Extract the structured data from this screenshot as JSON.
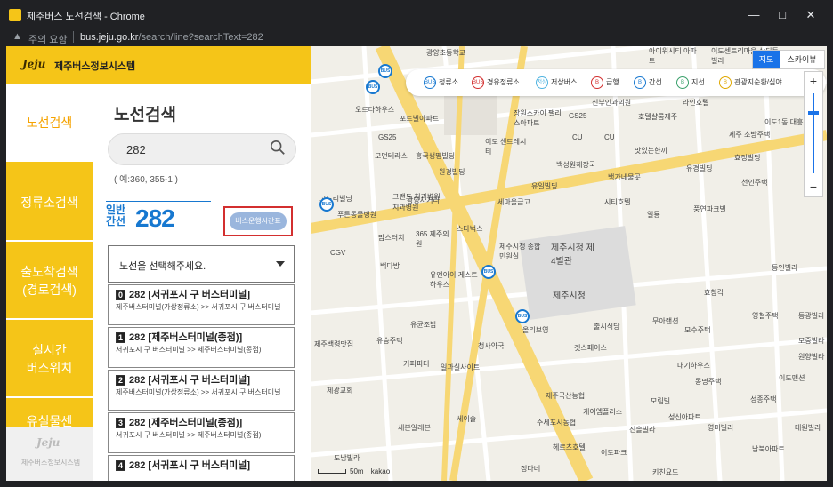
{
  "browser": {
    "title": "제주버스 노선검색 - Chrome",
    "security_note": "주의 요함",
    "url_host": "bus.jeju.go.kr",
    "url_path": "/search/line?searchText=282"
  },
  "header": {
    "logo_mark": "Jeju",
    "logo_text": "제주버스정보시스템"
  },
  "sidebar": {
    "items": [
      {
        "label": "노선검색",
        "active": true
      },
      {
        "label": "정류소검색"
      },
      {
        "label": "출도착검색",
        "label2": "(경로검색)"
      },
      {
        "label": "실시간",
        "label2": "버스위치"
      },
      {
        "label": "유실물센"
      }
    ],
    "footer_mark": "Jeju",
    "footer_text": "제주버스정보시스템"
  },
  "main": {
    "title": "노선검색",
    "search_value": "282",
    "example": "( 예:360, 355-1 )",
    "route_type_line1": "일반",
    "route_type_line2": "간선",
    "route_number": "282",
    "schedule_button": "버스운행시간표",
    "select_placeholder": "노선을 선택해주세요.",
    "routes": [
      {
        "index": "0",
        "title": "282 [서귀포시 구 버스터미널]",
        "desc": "제주버스터미널(가상정류소) >> 서귀포시 구 버스터미널"
      },
      {
        "index": "1",
        "title": "282 [제주버스터미널(종점)]",
        "desc": "서귀포시 구 버스터미널 >> 제주버스터미널(종점)"
      },
      {
        "index": "2",
        "title": "282 [서귀포시 구 버스터미널]",
        "desc": "제주버스터미널(가상정류소) >> 서귀포시 구 버스터미널"
      },
      {
        "index": "3",
        "title": "282 [제주버스터미널(종점)]",
        "desc": "서귀포시 구 버스터미널 >> 제주버스터미널(종점)"
      },
      {
        "index": "4",
        "title": "282 [서귀포시 구 버스터미널]",
        "desc": ""
      }
    ]
  },
  "map": {
    "map_type_on": "지도",
    "map_type_off": "스카이뷰",
    "zoom_in": "+",
    "zoom_out": "−",
    "legend": [
      {
        "label": "정류소",
        "color": "#1778d0",
        "icon": "BUS"
      },
      {
        "label": "경유정류소",
        "color": "#d32f2f",
        "icon": "BUS"
      },
      {
        "label": "저상버스",
        "color": "#4fb3e0",
        "icon": "저상"
      },
      {
        "label": "급행",
        "color": "#d32f2f",
        "icon": "B"
      },
      {
        "label": "간선",
        "color": "#1778d0",
        "icon": "B"
      },
      {
        "label": "지선",
        "color": "#3aa06b",
        "icon": "B"
      },
      {
        "label": "관광지순환/심야",
        "color": "#e0a800",
        "icon": "B"
      }
    ],
    "labels": [
      "광양초등학교",
      "원탑",
      "오르다하우스",
      "포트빌아파트",
      "GS25",
      "모던테라스",
      "흥국생명빌딩",
      "원경빌딩",
      "장원스카이 팰리스아파트",
      "GS25",
      "이도 센트레시티",
      "신부인과의원",
      "호텔샬롬제주",
      "라인호텔",
      "CU",
      "제주 소방주택",
      "이도1동 대흥빌라",
      "유경빌딩",
      "선인주택",
      "백성원해장국",
      "백가네물곳",
      "맛있는한끼",
      "유일빌딩",
      "세마을금고",
      "시티호텔",
      "일룡",
      "풍연파크빌",
      "고도리빌딩",
      "푸른동물병원",
      "치과병원",
      "그랜드 치과병원",
      "광양사거리",
      "스타벅스",
      "제주시청 종합민원실",
      "제주시청 제4별관",
      "제주시청",
      "맘스터치",
      "365 제주의원",
      "유엔아이 게스트하우스",
      "CGV",
      "백다방",
      "유균조밥",
      "유승주택",
      "올리브영",
      "청사약국",
      "커피피더",
      "일과실사이트",
      "출시식당",
      "겟스페이스",
      "무아랜션",
      "모수주택",
      "제광교회",
      "대기하우스",
      "동명주택",
      "제주국산농협",
      "케이엠플러스",
      "세이솔",
      "주세포시농협",
      "세븐일레븐",
      "모림빌",
      "성신아파트",
      "영미빌라",
      "진솔빌라",
      "헤르츠호텔",
      "이도파크",
      "이도맨션",
      "성종주택",
      "대원빌라",
      "도남빌라",
      "정다네",
      "남북아파트",
      "키친요드",
      "아이위시티 아파트",
      "이도센트리마을 삼디동빌라",
      "동인빌라",
      "효창각",
      "영철주택",
      "동광빌라",
      "모중빌라",
      "원양빌라",
      "제주백령맛집",
      "CU",
      "효정빌딩"
    ],
    "scale": "50m",
    "brand": "kakao"
  }
}
